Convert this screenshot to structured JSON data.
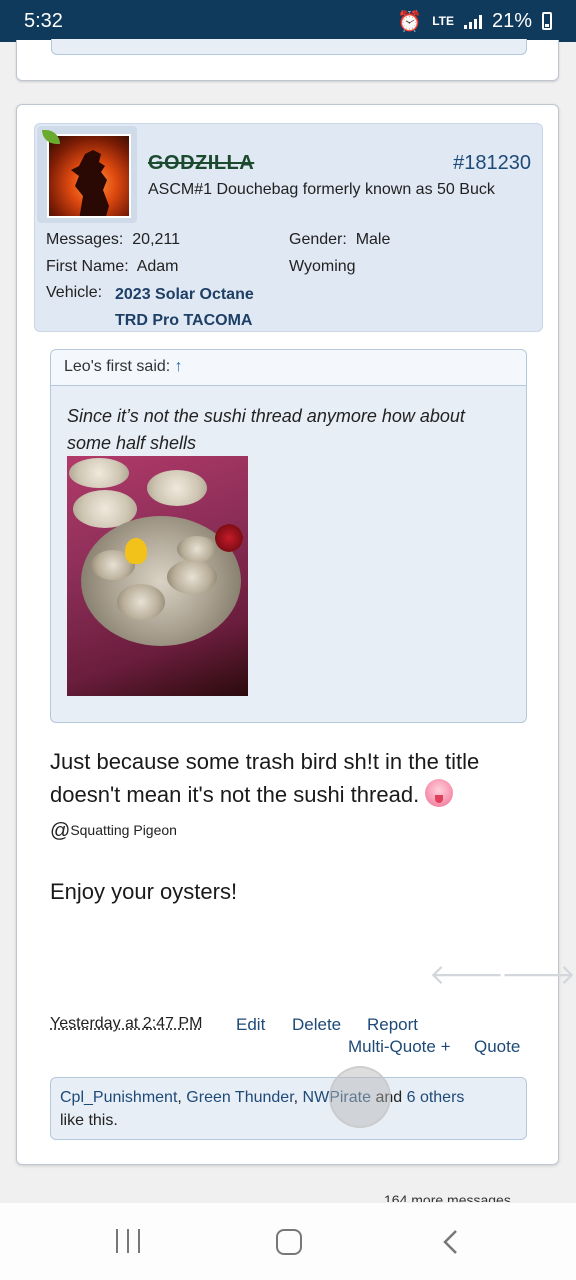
{
  "status_bar": {
    "time": "5:32",
    "network": "LTE",
    "battery": "21%"
  },
  "post": {
    "username": "GODZILLA",
    "post_number": "#181230",
    "user_title": "ASCM#1 Douchebag formerly known as 50 Buck",
    "stats": {
      "messages_label": "Messages:",
      "messages_value": "20,211",
      "first_name_label": "First Name:",
      "first_name_value": "Adam",
      "vehicle_label": "Vehicle:",
      "vehicle_value": "2023 Solar Octane TRD Pro TACOMA",
      "gender_label": "Gender:",
      "gender_value": "Male",
      "location": "Wyoming"
    },
    "quote": {
      "author_text": "Leo's first said:",
      "arrow": "↑",
      "text": "Since it’s not the sushi thread anymore how about some half shells"
    },
    "body_text": "Just because some trash bird sh!t in the title doesn't mean it's not the sushi thread.",
    "mention_at": "@",
    "mention_name": "Squatting Pigeon",
    "closing_text": "Enjoy your oysters!",
    "timestamp": "Yesterday at 2:47 PM",
    "actions": {
      "edit": "Edit",
      "delete": "Delete",
      "report": "Report",
      "multi_quote": "Multi-Quote +",
      "quote": "Quote"
    },
    "likes": {
      "name1": "Cpl_Punishment",
      "name2": "Green Thunder",
      "name3": "NWPirate",
      "and_text": "and",
      "others": "6 others",
      "suffix": "like this."
    }
  },
  "footer": {
    "more_messages": "164 more messages"
  },
  "colors": {
    "status_bar_bg": "#0f3a5b",
    "link": "#1e4a78",
    "user_block_bg": "#dfe8f3",
    "username_green": "#1c4a2f"
  }
}
